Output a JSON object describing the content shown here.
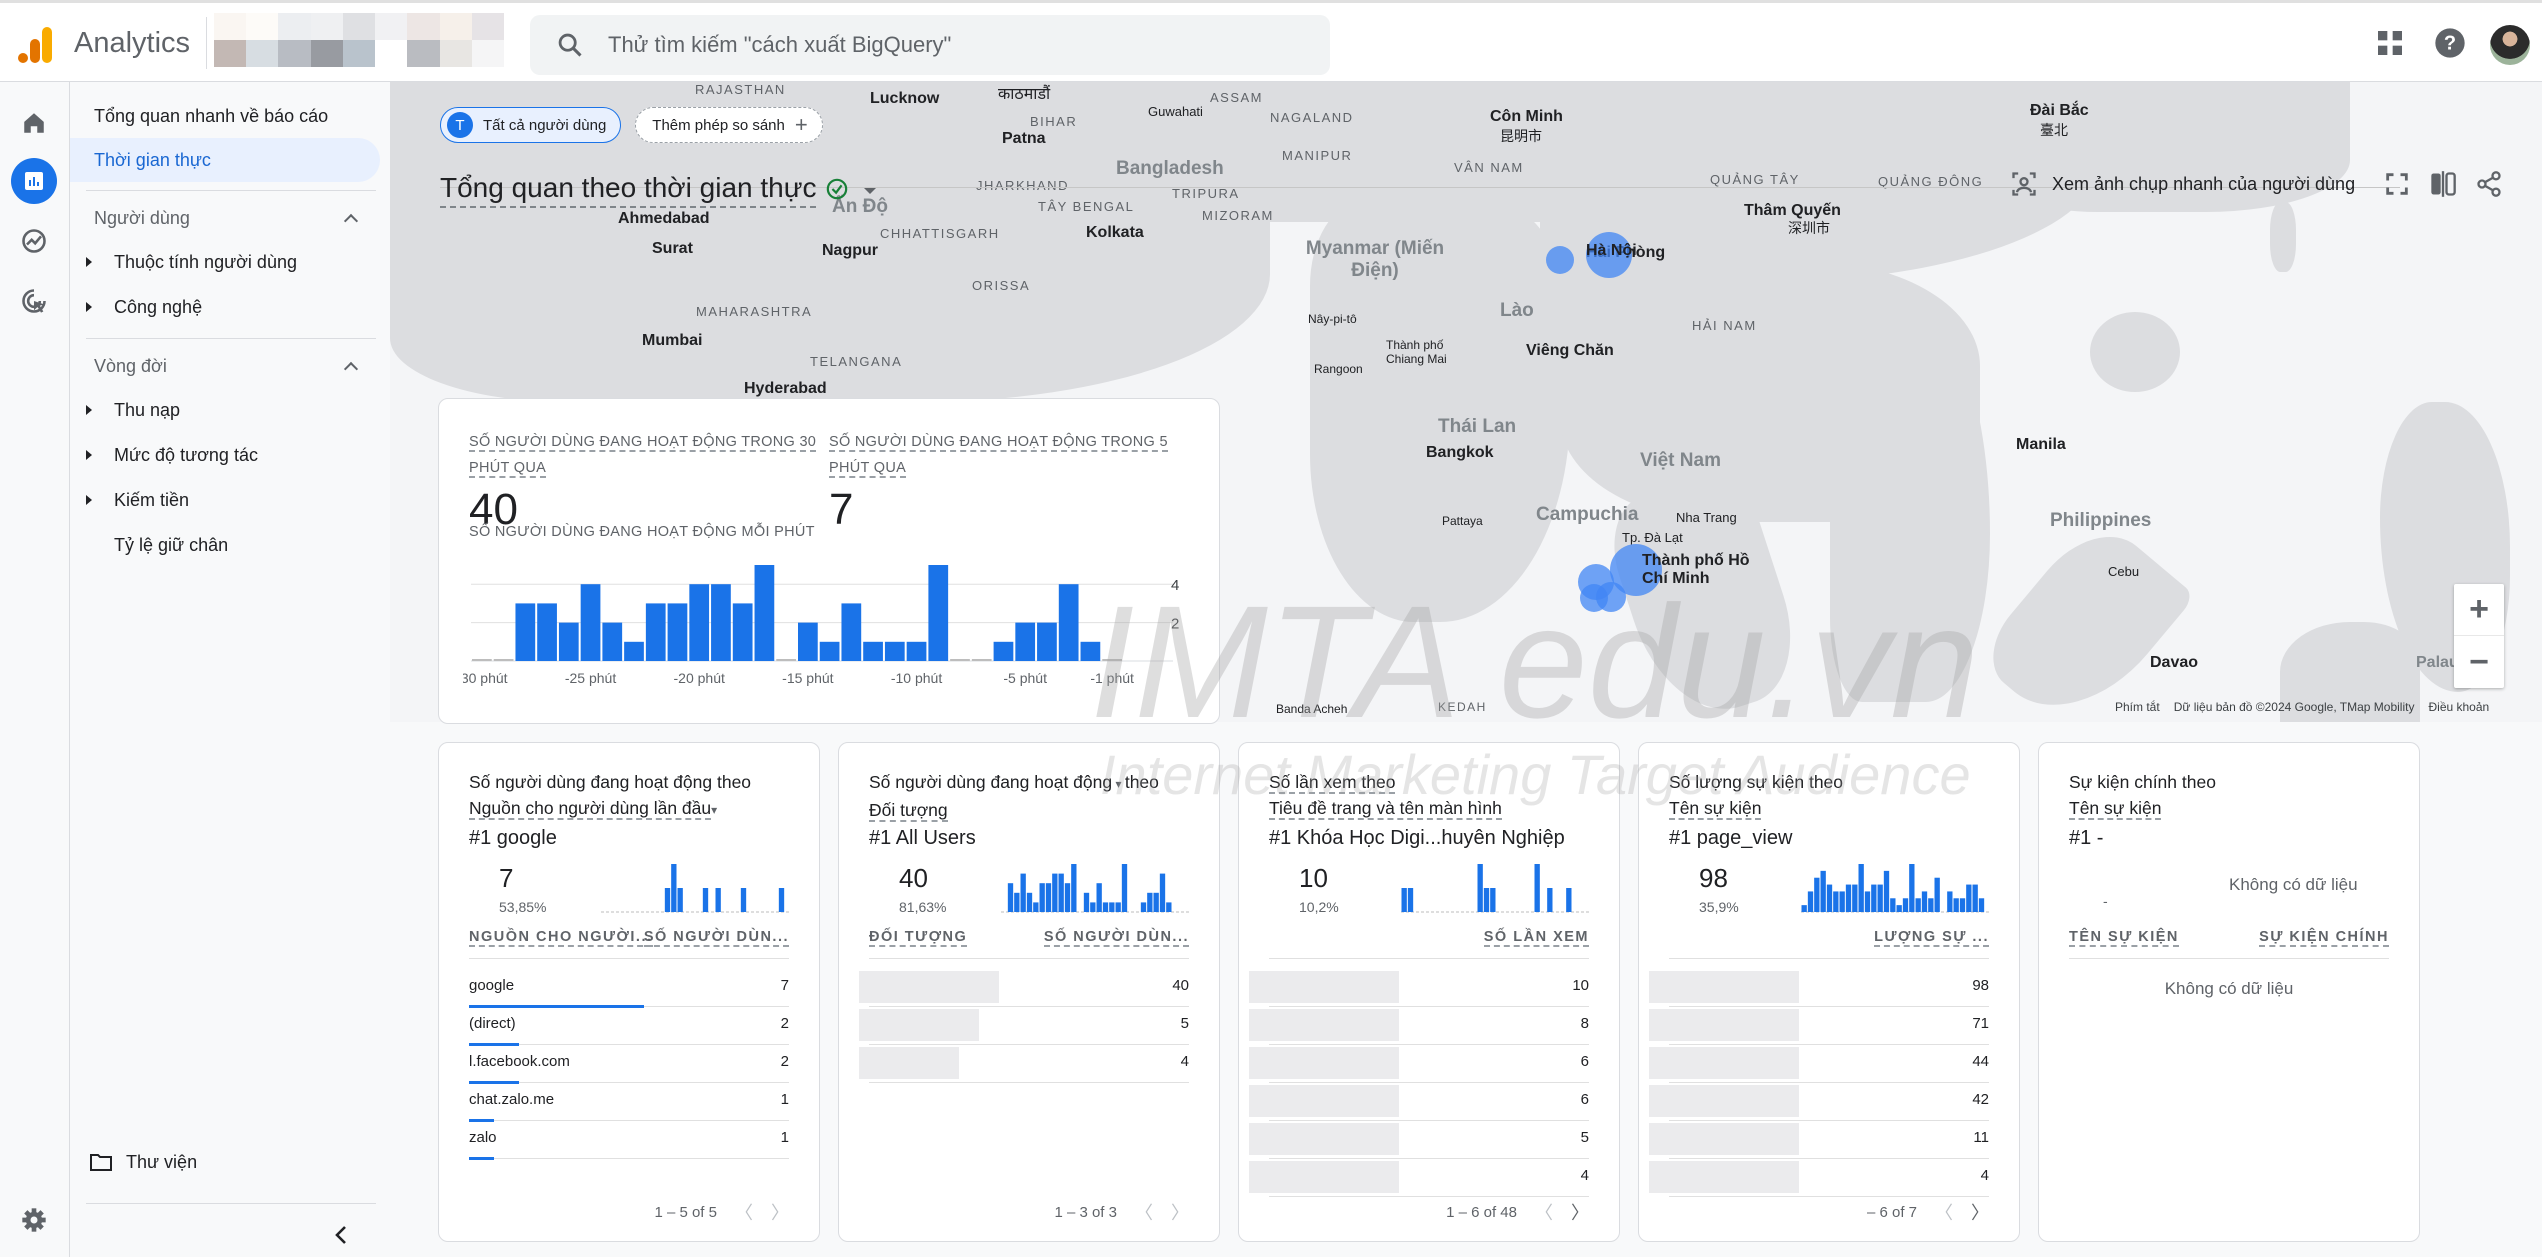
{
  "header": {
    "app_title": "Analytics",
    "search_placeholder": "Thử tìm kiếm \"cách xuất BigQuery\"",
    "icons": [
      "apps-grid-icon",
      "help-icon",
      "account-avatar"
    ]
  },
  "rail": [
    "home-icon",
    "reports-icon",
    "explore-icon",
    "advertising-icon",
    "settings-icon"
  ],
  "nav": {
    "quick_overview": "Tổng quan nhanh về báo cáo",
    "realtime": "Thời gian thực",
    "section_users": "Người dùng",
    "user_attributes": "Thuộc tính người dùng",
    "technology": "Công nghệ",
    "section_lifecycle": "Vòng đời",
    "acquisition": "Thu nạp",
    "engagement": "Mức độ tương tác",
    "monetization": "Kiếm tiền",
    "retention": "Tỷ lệ giữ chân",
    "library": "Thư viện"
  },
  "toolbar": {
    "chip_all_users": "Tất cả người dùng",
    "chip_all_users_initial": "T",
    "add_comparison": "Thêm phép so sánh",
    "page_title": "Tổng quan theo thời gian thực",
    "user_snapshot": "Xem ảnh chụp nhanh của người dùng"
  },
  "map": {
    "labels": {
      "rajasthan": "RAJASTHAN",
      "lucknow": "Lucknow",
      "kathmandu": "काठमाडौं",
      "guwahati": "Guwahati",
      "assam": "ASSAM",
      "nagaland": "NAGALAND",
      "bihar": "BIHAR",
      "patna": "Patna",
      "bangladesh": "Bangladesh",
      "manipur": "MANIPUR",
      "conminh": "Côn Minh",
      "conminh_cn": "昆明市",
      "vannam": "VÂN NAM",
      "jharkhand": "JHARKHAND",
      "tripura": "TRIPURA",
      "taybengal": "TÂY BENGAL",
      "mizoram": "MIZORAM",
      "ando": "Ấn Độ",
      "ahmedabad": "Ahmedabad",
      "chhattisgarh": "CHHATTISGARH",
      "kolkata": "Kolkata",
      "surat": "Surat",
      "nagpur": "Nagpur",
      "orissa": "ORISSA",
      "myanmar": "Myanmar (Miến Điện)",
      "maharashtra": "MAHARASHTRA",
      "mumbai": "Mumbai",
      "telangana": "TELANGANA",
      "hyderabad": "Hyderabad",
      "naypyidaw": "Nây-pi-tô",
      "rangoon": "Rangoon",
      "chiangmai": "Thành phố Chiang Mai",
      "lao": "Lào",
      "vientiane": "Viêng Chăn",
      "hanoi": "Hà Nội",
      "haiphong": "Hải Phòng",
      "hainam": "HẢI NAM",
      "thailand": "Thái Lan",
      "bangkok": "Bangkok",
      "vietnam": "Việt Nam",
      "campuchia": "Campuchia",
      "pattaya": "Pattaya",
      "nhatrang": "Nha Trang",
      "dalat": "Tp. Đà Lạt",
      "hcm": "Thành phố Hồ Chí Minh",
      "quangtay": "QUẢNG TÂY",
      "quangdong": "QUẢNG ĐÔNG",
      "thamquyen": "Thâm Quyến",
      "thamquyen_cn": "深圳市",
      "daibac": "Đài Bắc",
      "daibac_cn": "臺北",
      "manila": "Manila",
      "philippines": "Philippines",
      "cebu": "Cebu",
      "davao": "Davao",
      "palau": "Palau",
      "bandaacheh": "Banda Acheh",
      "kedah": "KEDAH"
    },
    "zoom_in": "+",
    "zoom_out": "−",
    "footer": {
      "shortcuts": "Phím tắt",
      "map_data": "Dữ liệu bản đồ ©2024 Google, TMap Mobility",
      "terms": "Điều khoản"
    }
  },
  "realtime_card": {
    "label_30min": "SỐ NGƯỜI DÙNG ĐANG HOẠT ĐỘNG TRONG 30 PHÚT QUA",
    "value_30min": "40",
    "label_5min": "SỐ NGƯỜI DÙNG ĐANG HOẠT ĐỘNG TRONG 5 PHÚT QUA",
    "value_5min": "7",
    "label_per_minute": "SỐ NGƯỜI DÙNG ĐANG HOẠT ĐỘNG MỖI PHÚT"
  },
  "chart_data": {
    "type": "bar",
    "title": "SỐ NGƯỜI DÙNG ĐANG HOẠT ĐỘNG MỖI PHÚT",
    "x_tick_labels": [
      "-30 phút",
      "-25 phút",
      "-20 phút",
      "-15 phút",
      "-10 phút",
      "-5 phút",
      "-1 phút"
    ],
    "x_tick_indices": [
      0,
      5,
      10,
      15,
      20,
      25,
      29
    ],
    "values": [
      0,
      0,
      3,
      3,
      2,
      4,
      2,
      1,
      3,
      3,
      4,
      4,
      3,
      5,
      0,
      2,
      1,
      3,
      1,
      1,
      1,
      5,
      0,
      0,
      1,
      2,
      2,
      4,
      1,
      0
    ],
    "y_ticks": [
      2,
      4
    ],
    "ylim": [
      0,
      5
    ],
    "grid": true,
    "color": "#1a73e8"
  },
  "cards": [
    {
      "title_pre": "Số người dùng đang hoạt động theo",
      "title_dim": "Nguồn cho người dùng lần đầu",
      "top": "#1  google",
      "value": "7",
      "pct": "53,85%",
      "spark": [
        0,
        0,
        0,
        0,
        0,
        0,
        0,
        0,
        0,
        0,
        2,
        4,
        2,
        0,
        0,
        0,
        2,
        0,
        2,
        0,
        0,
        0,
        2,
        0,
        0,
        0,
        0,
        0,
        2,
        0
      ],
      "col1": "NGUỒN CHO NGƯỜI...",
      "col2": "SỐ NGƯỜI DÙN...",
      "rows": [
        {
          "name": "google",
          "value": "7",
          "share": 1.0
        },
        {
          "name": "(direct)",
          "value": "2",
          "share": 0.2857
        },
        {
          "name": "l.facebook.com",
          "value": "2",
          "share": 0.2857
        },
        {
          "name": "chat.zalo.me",
          "value": "1",
          "share": 0.1429
        },
        {
          "name": "zalo",
          "value": "1",
          "share": 0.1429
        }
      ],
      "pager": "1 – 5 of 5"
    },
    {
      "title_pre": "Số người dùng đang hoạt động",
      "title_post": "theo",
      "title_dim": "Đối tượng",
      "top": "#1  All Users",
      "value": "40",
      "pct": "81,63%",
      "spark": [
        0,
        3,
        2,
        4,
        2,
        1,
        3,
        3,
        4,
        4,
        3,
        5,
        0,
        2,
        1,
        3,
        1,
        1,
        1,
        5,
        0,
        0,
        1,
        2,
        2,
        4,
        1,
        0,
        0,
        0
      ],
      "col1": "ĐỐI TƯỢNG",
      "col2": "SỐ NGƯỜI DÙN...",
      "rows": [
        {
          "name": "",
          "value": "40"
        },
        {
          "name": "",
          "value": "5"
        },
        {
          "name": "",
          "value": "4"
        }
      ],
      "pager": "1 – 3 of 3"
    },
    {
      "title_pre": "Số lần xem theo",
      "title_dim": "Tiêu đề trang và tên màn hình",
      "top": "#1  Khóa Học Digi...huyên Nghiệp",
      "value": "10",
      "pct": "10,2%",
      "spark": [
        2,
        2,
        0,
        0,
        0,
        0,
        0,
        0,
        0,
        0,
        0,
        0,
        4,
        2,
        2,
        0,
        0,
        0,
        0,
        0,
        0,
        4,
        0,
        2,
        0,
        0,
        2,
        0,
        0,
        0
      ],
      "col1": "",
      "col2": "SỐ LẦN XEM",
      "rows": [
        {
          "name": "",
          "value": "10"
        },
        {
          "name": "",
          "value": "8"
        },
        {
          "name": "",
          "value": "6"
        },
        {
          "name": "",
          "value": "6"
        },
        {
          "name": "",
          "value": "5"
        },
        {
          "name": "",
          "value": "4"
        }
      ],
      "pager": "1 – 6 of 48"
    },
    {
      "title_pre": "Số lượng sự kiện theo",
      "title_dim": "Tên sự kiện",
      "top": "#1  page_view",
      "value": "98",
      "pct": "35,9%",
      "spark": [
        1,
        3,
        5,
        6,
        4,
        3,
        3,
        4,
        4,
        7,
        3,
        4,
        4,
        6,
        2,
        1,
        2,
        7,
        2,
        3,
        2,
        5,
        0,
        3,
        2,
        2,
        4,
        4,
        2,
        0
      ],
      "col1": "",
      "col2": "LƯỢNG SỰ ...",
      "rows": [
        {
          "name": "",
          "value": "98"
        },
        {
          "name": "",
          "value": "71"
        },
        {
          "name": "",
          "value": "44"
        },
        {
          "name": "",
          "value": "42"
        },
        {
          "name": "",
          "value": "11"
        },
        {
          "name": "",
          "value": "4"
        }
      ],
      "pager": "– 6 of 7"
    },
    {
      "title_pre": "Sự kiện chính theo",
      "title_dim": "Tên sự kiện",
      "top": "#1  -",
      "no_data": "Không có dữ liệu",
      "dash": "-",
      "col1": "TÊN SỰ KIỆN",
      "col2": "SỰ KIỆN CHÍNH",
      "table_no_data": "Không có dữ liệu"
    }
  ],
  "watermark": {
    "main": "IMTA edu.vn",
    "sub": "Internet Marketing Target Audience"
  }
}
